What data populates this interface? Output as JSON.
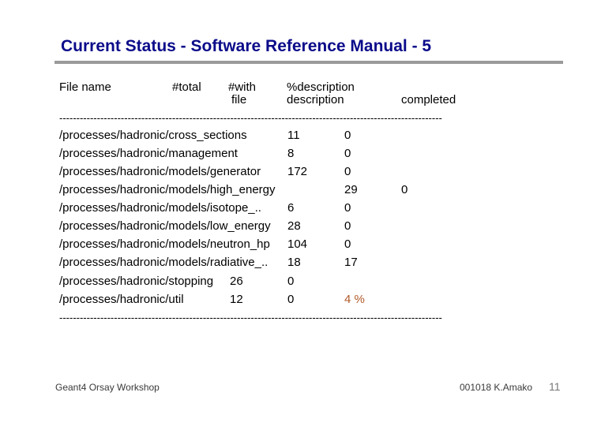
{
  "title": "Current Status - Software Reference Manual - 5",
  "header": {
    "file_name": "File name",
    "total": "#total",
    "with_line1": "#with",
    "with_line2": "file",
    "desc_line1": "%description",
    "desc_line2": "description",
    "completed": "completed"
  },
  "separator": "----------------------------------------------------------------------------------------------------------------",
  "rows": [
    {
      "path": "/processes/hadronic/cross_sections",
      "total": "11",
      "with": "0",
      "pct": ""
    },
    {
      "path": "/processes/hadronic/management",
      "total": "8",
      "with": "0",
      "pct": ""
    },
    {
      "path": "/processes/hadronic/models/generator",
      "total": "172",
      "with": "0",
      "pct": ""
    },
    {
      "path": "/processes/hadronic/models/high_energy",
      "total": "",
      "with": "29",
      "pct": "0"
    },
    {
      "path": "/processes/hadronic/models/isotope_..",
      "total": "6",
      "with": "0",
      "pct": ""
    },
    {
      "path": "/processes/hadronic/models/low_energy",
      "total": "28",
      "with": "0",
      "pct": ""
    },
    {
      "path": "/processes/hadronic/models/neutron_hp",
      "total": "104",
      "with": "0",
      "pct": ""
    },
    {
      "path": "/processes/hadronic/models/radiative_..",
      "total": "18",
      "with": "17",
      "pct": ""
    },
    {
      "path": "/processes/hadronic/stopping",
      "total": "26",
      "with": "0",
      "pct": ""
    },
    {
      "path": "/processes/hadronic/util",
      "total": "12",
      "with": "0",
      "pct": ""
    }
  ],
  "summary_pct": "4 %",
  "footer": {
    "left": "Geant4 Orsay Workshop",
    "right": "001018  K.Amako",
    "page": "11"
  }
}
